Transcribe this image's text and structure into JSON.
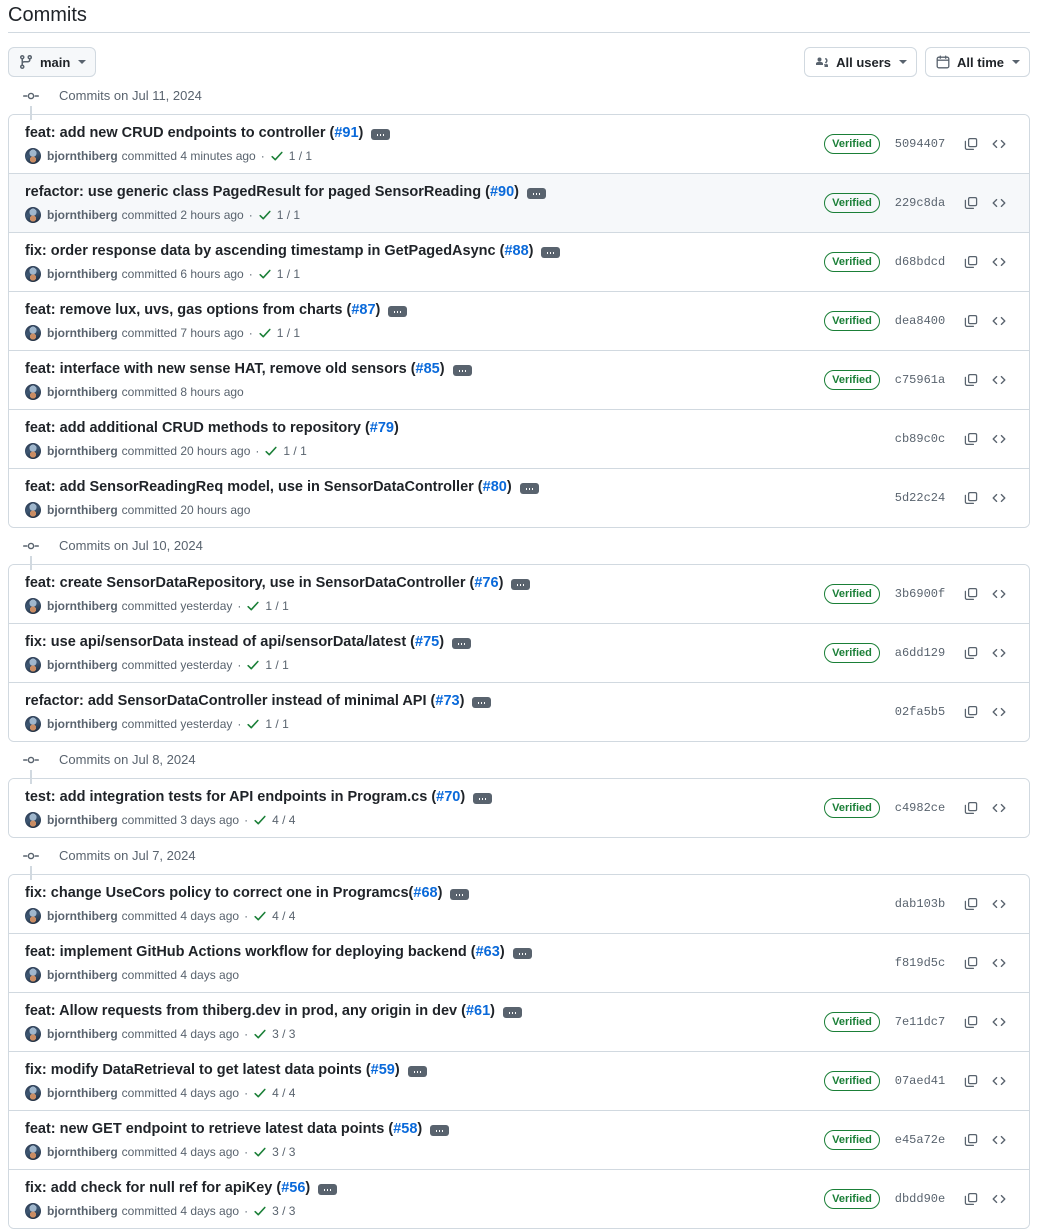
{
  "header": {
    "title": "Commits"
  },
  "toolbar": {
    "branch_label": "main",
    "branch_icon": "git-branch-icon",
    "users_filter_label": "All users",
    "users_filter_icon": "people-icon",
    "time_filter_label": "All time",
    "time_filter_icon": "calendar-icon"
  },
  "colors": {
    "link": "#0969da",
    "verified_green": "#1a7f37",
    "muted": "#59636e",
    "border": "#d1d9e0",
    "alt_row_bg": "#f6f8fa"
  },
  "groups": [
    {
      "header": "Commits on Jul 11, 2024",
      "commits": [
        {
          "title": "feat: add new CRUD endpoints to controller (",
          "pr": "#91",
          "title_suffix": ")",
          "author": "bjornthiberg",
          "meta": "committed 4 minutes ago",
          "has_checks": true,
          "checks": "1 / 1",
          "verified": "Verified",
          "sha": "5094407",
          "alt": false
        },
        {
          "title": "refactor: use generic class PagedResult for paged SensorReading (",
          "pr": "#90",
          "title_suffix": ")",
          "author": "bjornthiberg",
          "meta": "committed 2 hours ago",
          "has_checks": true,
          "checks": "1 / 1",
          "verified": "Verified",
          "sha": "229c8da",
          "alt": true
        },
        {
          "title": "fix: order response data by ascending timestamp in GetPagedAsync (",
          "pr": "#88",
          "title_suffix": ")",
          "author": "bjornthiberg",
          "meta": "committed 6 hours ago",
          "has_checks": true,
          "checks": "1 / 1",
          "verified": "Verified",
          "sha": "d68bdcd",
          "alt": false
        },
        {
          "title": "feat: remove lux, uvs, gas options from charts (",
          "pr": "#87",
          "title_suffix": ")",
          "author": "bjornthiberg",
          "meta": "committed 7 hours ago",
          "has_checks": true,
          "checks": "1 / 1",
          "verified": "Verified",
          "sha": "dea8400",
          "alt": false
        },
        {
          "title": "feat: interface with new sense HAT, remove old sensors (",
          "pr": "#85",
          "title_suffix": ")",
          "author": "bjornthiberg",
          "meta": "committed 8 hours ago",
          "has_checks": false,
          "checks": "",
          "verified": "Verified",
          "sha": "c75961a",
          "alt": false
        },
        {
          "title": "feat: add additional CRUD methods to repository (",
          "pr": "#79",
          "title_suffix": ")",
          "author": "bjornthiberg",
          "meta": "committed 20 hours ago",
          "has_checks": true,
          "checks": "1 / 1",
          "verified": "",
          "sha": "cb89c0c",
          "alt": false,
          "no_expand": true
        },
        {
          "title": "feat: add SensorReadingReq model, use in SensorDataController (",
          "pr": "#80",
          "title_suffix": ")",
          "author": "bjornthiberg",
          "meta": "committed 20 hours ago",
          "has_checks": false,
          "checks": "",
          "verified": "",
          "sha": "5d22c24",
          "alt": false
        }
      ]
    },
    {
      "header": "Commits on Jul 10, 2024",
      "commits": [
        {
          "title": "feat: create SensorDataRepository, use in SensorDataController (",
          "pr": "#76",
          "title_suffix": ")",
          "author": "bjornthiberg",
          "meta": "committed yesterday",
          "has_checks": true,
          "checks": "1 / 1",
          "verified": "Verified",
          "sha": "3b6900f",
          "alt": false
        },
        {
          "title": "fix: use api/sensorData instead of api/sensorData/latest (",
          "pr": "#75",
          "title_suffix": ")",
          "author": "bjornthiberg",
          "meta": "committed yesterday",
          "has_checks": true,
          "checks": "1 / 1",
          "verified": "Verified",
          "sha": "a6dd129",
          "alt": false
        },
        {
          "title": "refactor: add SensorDataController instead of minimal API (",
          "pr": "#73",
          "title_suffix": ")",
          "author": "bjornthiberg",
          "meta": "committed yesterday",
          "has_checks": true,
          "checks": "1 / 1",
          "verified": "",
          "sha": "02fa5b5",
          "alt": false
        }
      ]
    },
    {
      "header": "Commits on Jul 8, 2024",
      "commits": [
        {
          "title": "test: add integration tests for API endpoints in Program.cs (",
          "pr": "#70",
          "title_suffix": ")",
          "author": "bjornthiberg",
          "meta": "committed 3 days ago",
          "has_checks": true,
          "checks": "4 / 4",
          "verified": "Verified",
          "sha": "c4982ce",
          "alt": false
        }
      ]
    },
    {
      "header": "Commits on Jul 7, 2024",
      "commits": [
        {
          "title": "fix: change UseCors policy to correct one in Programcs(",
          "pr": "#68",
          "title_suffix": ")",
          "author": "bjornthiberg",
          "meta": "committed 4 days ago",
          "has_checks": true,
          "checks": "4 / 4",
          "verified": "",
          "sha": "dab103b",
          "alt": false
        },
        {
          "title": "feat: implement GitHub Actions workflow for deploying backend (",
          "pr": "#63",
          "title_suffix": ")",
          "author": "bjornthiberg",
          "meta": "committed 4 days ago",
          "has_checks": false,
          "checks": "",
          "verified": "",
          "sha": "f819d5c",
          "alt": false
        },
        {
          "title": "feat: Allow requests from thiberg.dev in prod, any origin in dev (",
          "pr": "#61",
          "title_suffix": ")",
          "author": "bjornthiberg",
          "meta": "committed 4 days ago",
          "has_checks": true,
          "checks": "3 / 3",
          "verified": "Verified",
          "sha": "7e11dc7",
          "alt": false
        },
        {
          "title": "fix: modify DataRetrieval to get latest data points (",
          "pr": "#59",
          "title_suffix": ")",
          "author": "bjornthiberg",
          "meta": "committed 4 days ago",
          "has_checks": true,
          "checks": "4 / 4",
          "verified": "Verified",
          "sha": "07aed41",
          "alt": false
        },
        {
          "title": "feat: new GET endpoint to retrieve latest data points (",
          "pr": "#58",
          "title_suffix": ")",
          "author": "bjornthiberg",
          "meta": "committed 4 days ago",
          "has_checks": true,
          "checks": "3 / 3",
          "verified": "Verified",
          "sha": "e45a72e",
          "alt": false
        },
        {
          "title": "fix: add check for null ref for apiKey (",
          "pr": "#56",
          "title_suffix": ")",
          "author": "bjornthiberg",
          "meta": "committed 4 days ago",
          "has_checks": true,
          "checks": "3 / 3",
          "verified": "Verified",
          "sha": "dbdd90e",
          "alt": false
        }
      ]
    }
  ],
  "icons": {
    "copy": "copy-icon",
    "code": "code-icon",
    "expand": "expand-commit-message-button",
    "check": "check-success-icon",
    "timeline_node": "timeline-node-icon"
  }
}
